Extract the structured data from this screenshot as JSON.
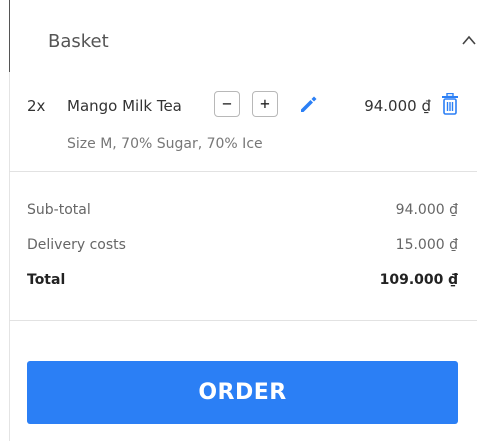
{
  "basket": {
    "title": "Basket",
    "collapse_icon": "chevron-up-icon"
  },
  "items": [
    {
      "quantity": "2x",
      "name": "Mango Milk Tea",
      "decrement_label": "−",
      "increment_label": "+",
      "edit_icon": "pencil-icon",
      "price": "94.000 ₫",
      "delete_icon": "trash-icon",
      "options": "Size M, 70% Sugar, 70% Ice"
    }
  ],
  "summary": {
    "subtotal_label": "Sub-total",
    "subtotal_value": "94.000 ₫",
    "delivery_label": "Delivery costs",
    "delivery_value": "15.000 ₫",
    "total_label": "Total",
    "total_value": "109.000 ₫"
  },
  "order_button_label": "ORDER",
  "colors": {
    "accent": "#2b7ff5",
    "text": "#333333",
    "muted": "#777777"
  }
}
